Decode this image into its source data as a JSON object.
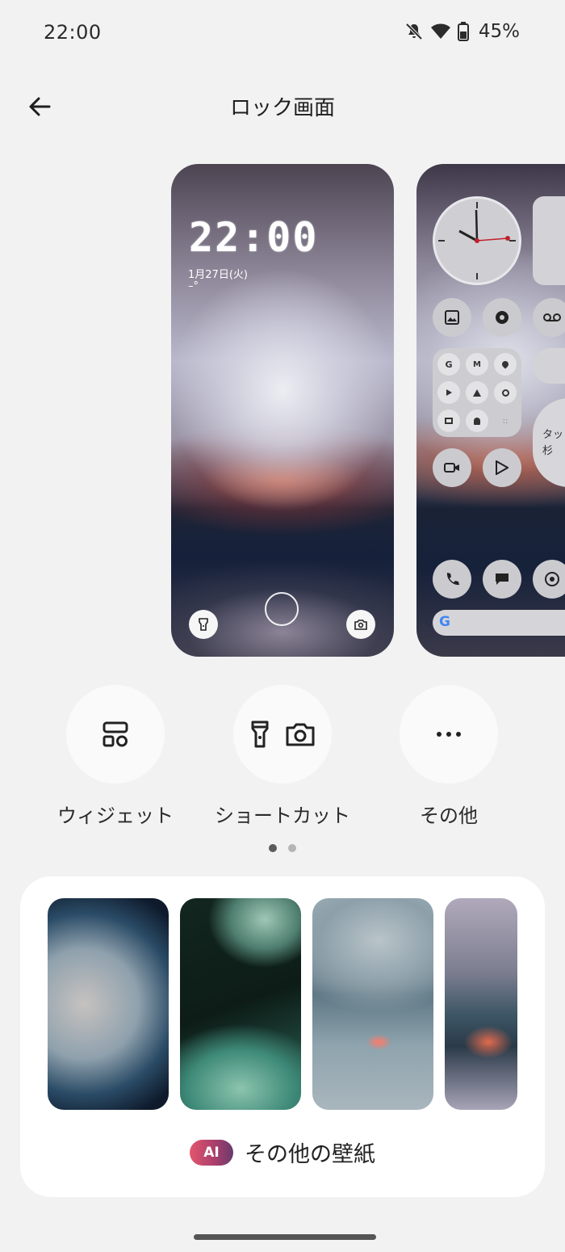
{
  "status_bar": {
    "time": "22:00",
    "battery": "45%"
  },
  "header": {
    "title": "ロック画面"
  },
  "lock_preview": {
    "clock": "22:00",
    "date": "1月27日(火)",
    "temperature": "–°"
  },
  "home_preview": {
    "widget_text": "タッ\n杉"
  },
  "options": [
    {
      "label": "ウィジェット",
      "icon": "widgets-icon"
    },
    {
      "label": "ショートカット",
      "icon": "flashlight-camera-icon"
    },
    {
      "label": "その他",
      "icon": "more-horizontal-icon"
    }
  ],
  "pager": {
    "page": 1,
    "total": 2
  },
  "wallpapers": {
    "badge": "AI",
    "more_label": "その他の壁紙"
  },
  "colors": {
    "background": "#f2f2f2",
    "card": "#ffffff",
    "accent_ai": "#e3566e"
  }
}
